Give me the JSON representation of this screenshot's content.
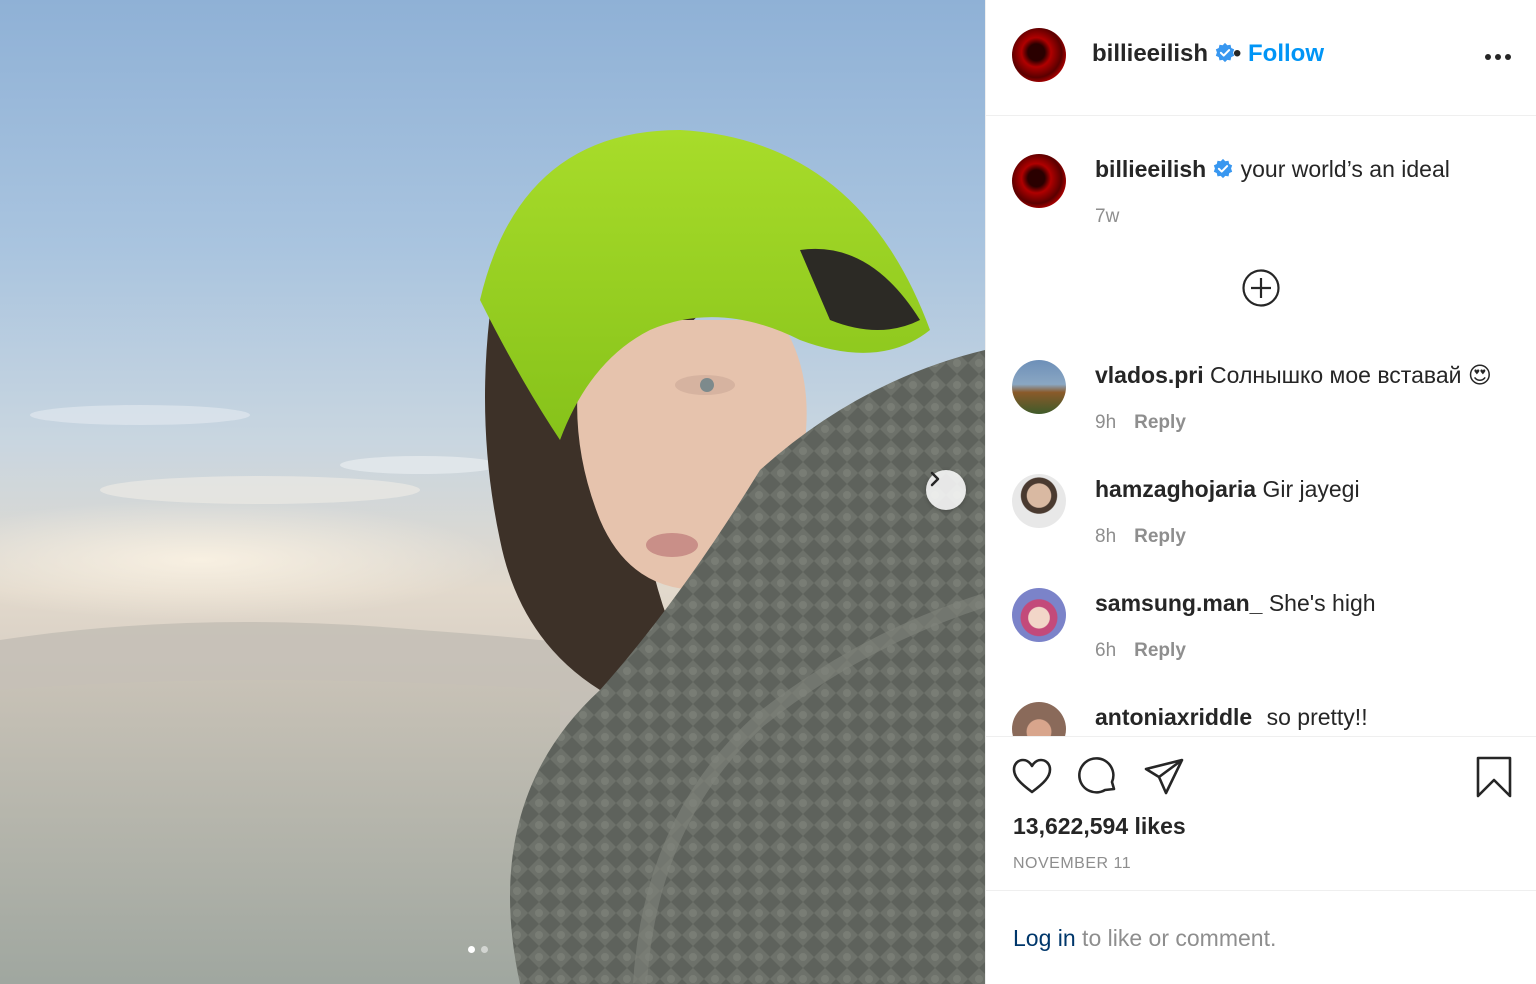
{
  "post": {
    "username": "billieeilish",
    "follow_label": "Follow",
    "separator": "•",
    "caption": "your world’s an ideal",
    "caption_age": "7w"
  },
  "comments": [
    {
      "username": "vlados.pri",
      "text": "Солнышко мое вставай",
      "emoji": "😍",
      "age": "9h",
      "reply_label": "Reply"
    },
    {
      "username": "hamzaghojaria",
      "text": "Gir jayegi",
      "age": "8h",
      "reply_label": "Reply"
    },
    {
      "username": "samsung.man_",
      "text": "She's high",
      "age": "6h",
      "reply_label": "Reply"
    },
    {
      "username": "antoniaxriddle",
      "text": "so pretty!!",
      "age": "",
      "reply_label": ""
    }
  ],
  "stats": {
    "likes": "13,622,594 likes",
    "date": "NOVEMBER 11"
  },
  "login": {
    "link_label": "Log in",
    "rest": " to like or comment."
  },
  "icons": {
    "verified": "verified-badge-icon",
    "more": "more-options-icon",
    "load_more": "plus-circle-icon",
    "like": "heart-icon",
    "comment": "comment-bubble-icon",
    "share": "paper-plane-icon",
    "save": "bookmark-icon",
    "next": "chevron-right-icon"
  },
  "colors": {
    "link_blue": "#0095f6",
    "verified_blue": "#3897f0",
    "muted_text": "#8e8e8e",
    "hair_green": "#9bd320"
  },
  "carousel": {
    "count": 2,
    "active": 0
  }
}
